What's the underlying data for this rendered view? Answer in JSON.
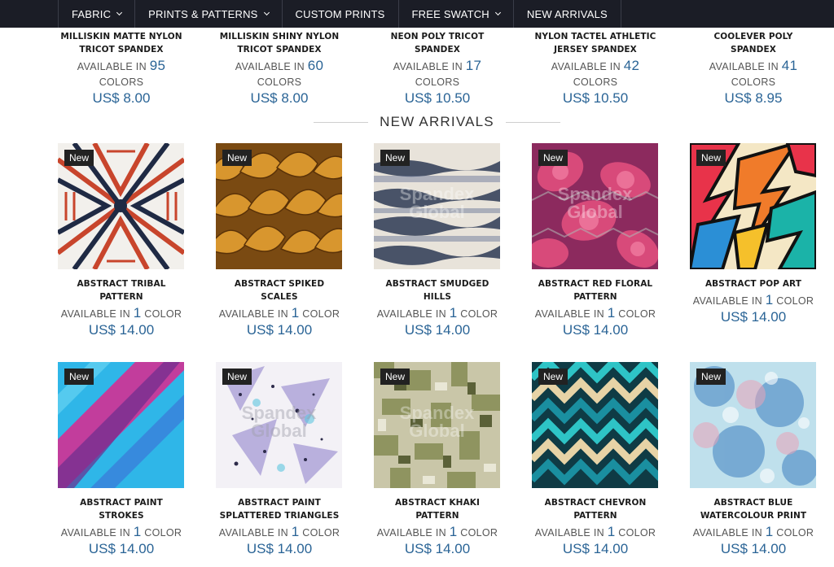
{
  "nav": {
    "items": [
      {
        "label": "FABRIC",
        "dropdown": true
      },
      {
        "label": "PRINTS & PATTERNS",
        "dropdown": true
      },
      {
        "label": "CUSTOM PRINTS",
        "dropdown": false
      },
      {
        "label": "FREE SWATCH",
        "dropdown": true
      },
      {
        "label": "NEW ARRIVALS",
        "dropdown": false
      }
    ]
  },
  "top_products": [
    {
      "name": "MILLISKIN MATTE NYLON TRICOT SPANDEX",
      "avail_prefix": "AVAILABLE IN",
      "count": "95",
      "avail_suffix": "COLORS",
      "price": "US$ 8.00"
    },
    {
      "name": "MILLISKIN SHINY NYLON TRICOT SPANDEX",
      "avail_prefix": "AVAILABLE IN",
      "count": "60",
      "avail_suffix": "COLORS",
      "price": "US$ 8.00"
    },
    {
      "name": "NEON POLY TRICOT SPANDEX",
      "avail_prefix": "AVAILABLE IN",
      "count": "17",
      "avail_suffix": "COLORS",
      "price": "US$ 10.50"
    },
    {
      "name": "NYLON TACTEL ATHLETIC JERSEY SPANDEX",
      "avail_prefix": "AVAILABLE IN",
      "count": "42",
      "avail_suffix": "COLORS",
      "price": "US$ 10.50"
    },
    {
      "name": "COOLEVER POLY SPANDEX",
      "avail_prefix": "AVAILABLE IN",
      "count": "41",
      "avail_suffix": "COLORS",
      "price": "US$ 8.95"
    }
  ],
  "section_title": "NEW ARRIVALS",
  "badge": "New",
  "watermark": "Spandex Global",
  "new_arrivals": [
    {
      "name": "ABSTRACT TRIBAL PATTERN",
      "avail_prefix": "AVAILABLE IN",
      "count": "1",
      "avail_suffix": "COLOR",
      "price": "US$ 14.00",
      "pattern": "tribal"
    },
    {
      "name": "ABSTRACT SPIKED SCALES",
      "avail_prefix": "AVAILABLE IN",
      "count": "1",
      "avail_suffix": "COLOR",
      "price": "US$ 14.00",
      "pattern": "scales"
    },
    {
      "name": "ABSTRACT SMUDGED HILLS",
      "avail_prefix": "AVAILABLE IN",
      "count": "1",
      "avail_suffix": "COLOR",
      "price": "US$ 14.00",
      "pattern": "hills"
    },
    {
      "name": "ABSTRACT RED FLORAL PATTERN",
      "avail_prefix": "AVAILABLE IN",
      "count": "1",
      "avail_suffix": "COLOR",
      "price": "US$ 14.00",
      "pattern": "floral"
    },
    {
      "name": "ABSTRACT POP ART",
      "avail_prefix": "AVAILABLE IN",
      "count": "1",
      "avail_suffix": "COLOR",
      "price": "US$ 14.00",
      "pattern": "popart"
    },
    {
      "name": "ABSTRACT PAINT STROKES",
      "avail_prefix": "AVAILABLE IN",
      "count": "1",
      "avail_suffix": "COLOR",
      "price": "US$ 14.00",
      "pattern": "strokes"
    },
    {
      "name": "ABSTRACT PAINT SPLATTERED TRIANGLES",
      "avail_prefix": "AVAILABLE IN",
      "count": "1",
      "avail_suffix": "COLOR",
      "price": "US$ 14.00",
      "pattern": "triangles"
    },
    {
      "name": "ABSTRACT KHAKI PATTERN",
      "avail_prefix": "AVAILABLE IN",
      "count": "1",
      "avail_suffix": "COLOR",
      "price": "US$ 14.00",
      "pattern": "khaki"
    },
    {
      "name": "ABSTRACT CHEVRON PATTERN",
      "avail_prefix": "AVAILABLE IN",
      "count": "1",
      "avail_suffix": "COLOR",
      "price": "US$ 14.00",
      "pattern": "chevron"
    },
    {
      "name": "ABSTRACT BLUE WATERCOLOUR PRINT",
      "avail_prefix": "AVAILABLE IN",
      "count": "1",
      "avail_suffix": "COLOR",
      "price": "US$ 14.00",
      "pattern": "watercolour"
    }
  ],
  "colors": {
    "nav_bg": "#1b1d26",
    "price": "#2a6496"
  }
}
